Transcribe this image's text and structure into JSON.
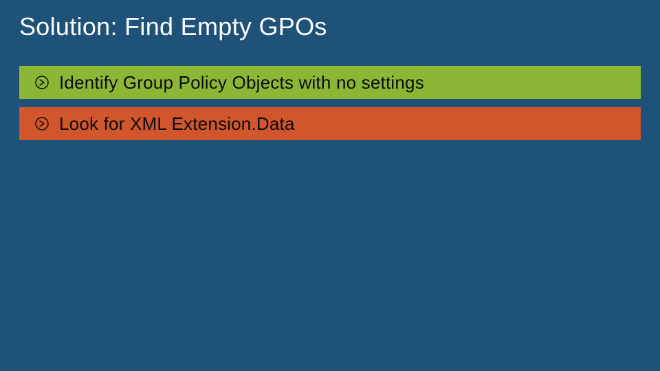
{
  "slide": {
    "title": "Solution: Find Empty GPOs",
    "bullets": [
      {
        "text": "Identify Group Policy Objects with no settings",
        "color": "#8bb735"
      },
      {
        "text": "Look for XML Extension.Data",
        "color": "#d2562c"
      }
    ]
  }
}
